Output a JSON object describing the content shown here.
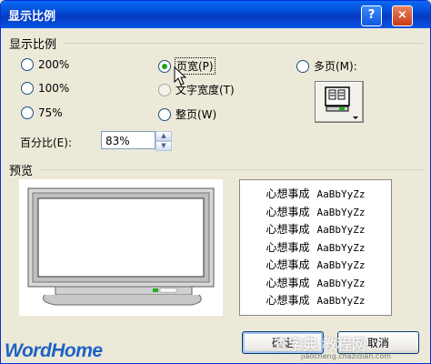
{
  "dialog": {
    "title": "显示比例",
    "help_glyph": "?",
    "close_glyph": "×"
  },
  "zoom_group": {
    "label": "显示比例",
    "options": [
      {
        "label": "200%",
        "selected": false,
        "enabled": true
      },
      {
        "label": "100%",
        "selected": false,
        "enabled": true
      },
      {
        "label": "75%",
        "selected": false,
        "enabled": true
      },
      {
        "label": "页宽(P)",
        "selected": true,
        "enabled": true
      },
      {
        "label": "文字宽度(T)",
        "selected": false,
        "enabled": false
      },
      {
        "label": "整页(W)",
        "selected": false,
        "enabled": true
      },
      {
        "label": "多页(M):",
        "selected": false,
        "enabled": true
      }
    ],
    "percent_label": "百分比(E):",
    "percent_value": "83%"
  },
  "preview": {
    "label": "预览",
    "sample_rows": [
      {
        "cjk": "心想事成",
        "latin": "AaBbYyZz"
      },
      {
        "cjk": "心想事成",
        "latin": "AaBbYyZz"
      },
      {
        "cjk": "心想事成",
        "latin": "AaBbYyZz"
      },
      {
        "cjk": "心想事成",
        "latin": "AaBbYyZz"
      },
      {
        "cjk": "心想事成",
        "latin": "AaBbYyZz"
      },
      {
        "cjk": "心想事成",
        "latin": "AaBbYyZz"
      },
      {
        "cjk": "心想事成",
        "latin": "AaBbYyZz"
      }
    ]
  },
  "buttons": {
    "ok": "确定",
    "cancel": "取消"
  },
  "watermarks": {
    "brand": "WordHome",
    "site_cn": "查字典 教程网",
    "site_url": "jiaocheng.chazidian.com"
  },
  "colors": {
    "titlebar": "#0a5bd9",
    "brand": "#1e62c4",
    "selected_radio": "#21a121"
  }
}
